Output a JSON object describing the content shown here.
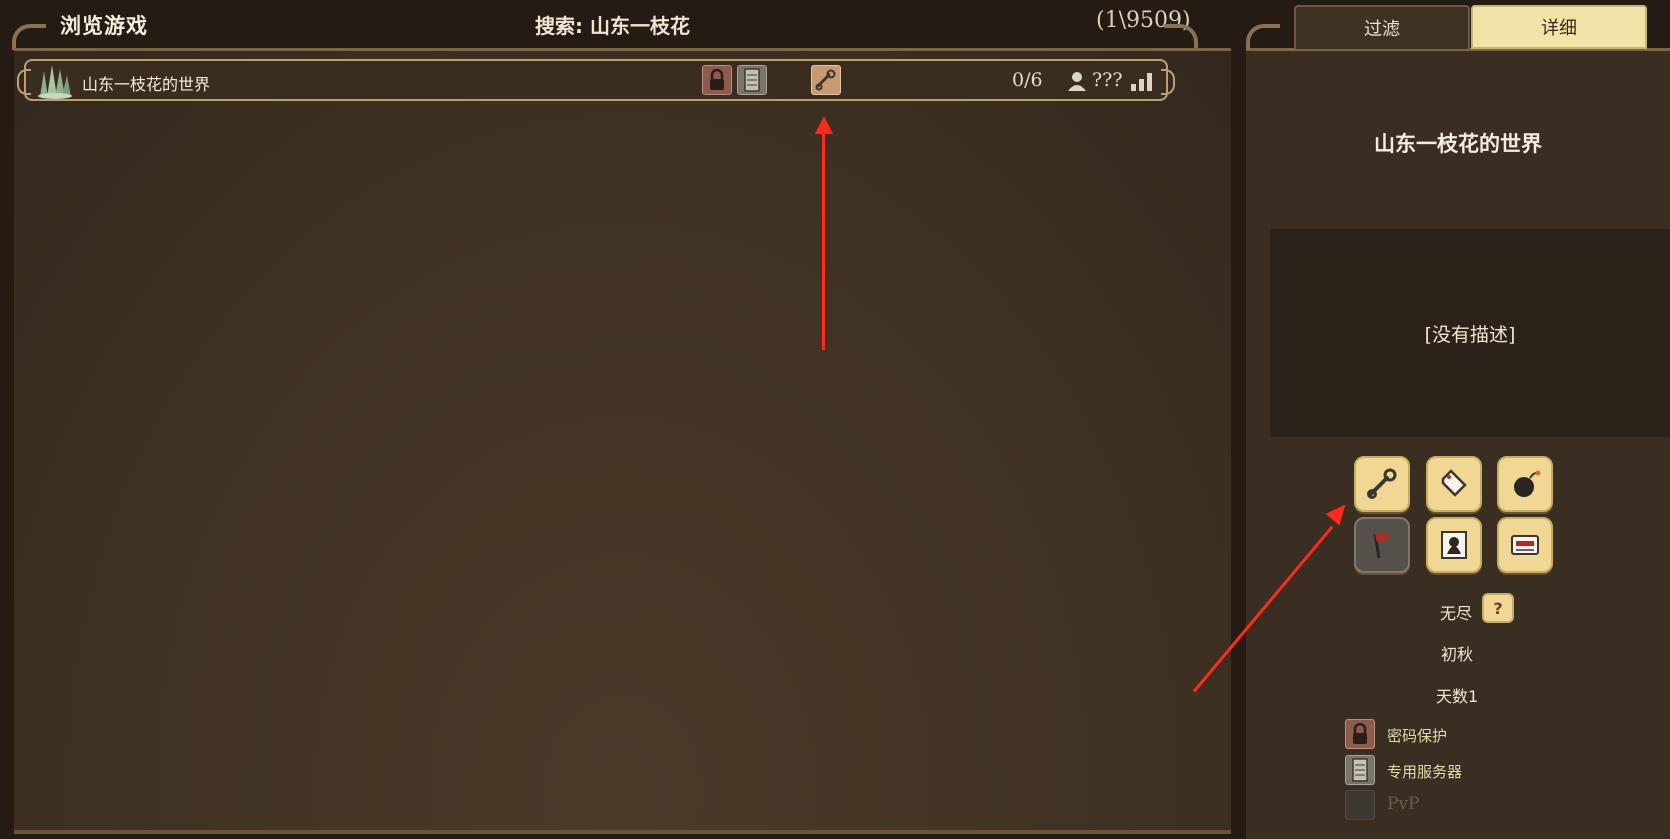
{
  "header": {
    "title": "浏览游戏",
    "search_label": "搜索: 山东一枝花",
    "result_count": "(1\\9509)"
  },
  "server_row": {
    "name": "山东一枝花的世界",
    "players": "0/6",
    "ping": "???",
    "badges": [
      "lock-icon",
      "server-icon",
      "wrench-icon"
    ]
  },
  "tabs": {
    "filter": "过滤",
    "details": "详细"
  },
  "details": {
    "server_name": "山东一枝花的世界",
    "description": "[没有描述]",
    "game_mode": "无尽",
    "help_icon": "?",
    "season": "初秋",
    "days": "天数1",
    "tags": [
      {
        "icon": "lock-icon",
        "label": "密码保护"
      },
      {
        "icon": "server-icon",
        "label": "专用服务器"
      },
      {
        "icon": "blank-icon",
        "label": "PvP"
      }
    ]
  },
  "colors": {
    "accent_gold": "#f0d793",
    "panel_brown": "#433425",
    "arrow_red": "#ff2a1a"
  }
}
